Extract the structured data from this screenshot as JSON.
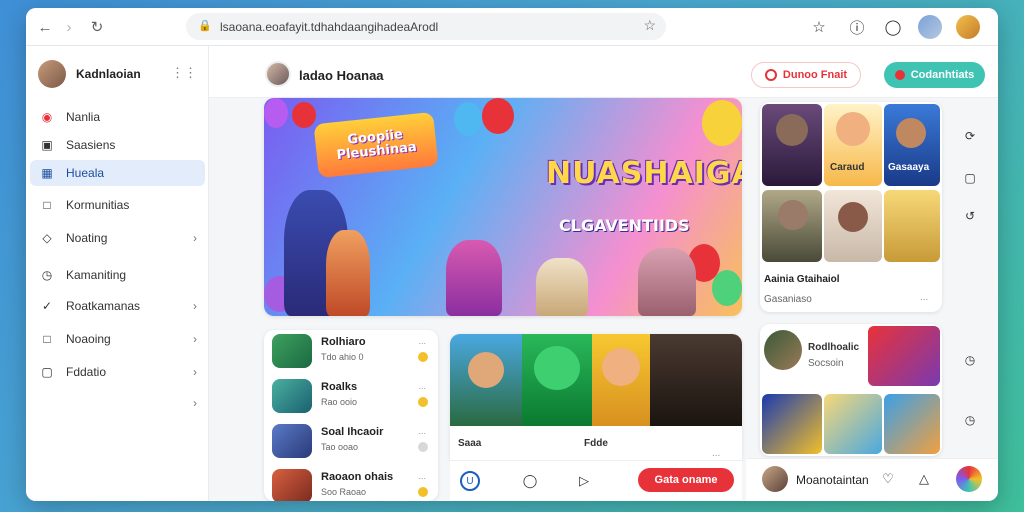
{
  "browser": {
    "address": "lsaoana.eoafayit.tdhahdaangihadeaArodl",
    "back_icon": "arrow-left-icon",
    "forward_icon": "arrow-right-icon",
    "reload_icon": "reload-icon"
  },
  "sidebar": {
    "user_name": "Kadnlaoian",
    "items": [
      {
        "label": "Nanlia",
        "icon": "record-icon",
        "chevron": false
      },
      {
        "label": "Saasiens",
        "icon": "tv-icon",
        "chevron": false
      },
      {
        "label": "Hueala",
        "icon": "grid-icon",
        "chevron": false
      },
      {
        "label": "Kormunitias",
        "icon": "chat-icon",
        "chevron": false
      },
      {
        "label": "Noating",
        "icon": "tag-icon",
        "chevron": true
      },
      {
        "label": "Kamaniting",
        "icon": "clock-icon",
        "chevron": false
      },
      {
        "label": "Roatkamanas",
        "icon": "share-icon",
        "chevron": true
      },
      {
        "label": "Noaoing",
        "icon": "box-icon",
        "chevron": true
      },
      {
        "label": "Fddatio",
        "icon": "doc-icon",
        "chevron": true
      }
    ],
    "active_index": 2
  },
  "header": {
    "title": "ladao Hoanaa",
    "pill_left": "Dunoo Fnait",
    "pill_right": "Codanhtiats"
  },
  "hero": {
    "logo_text_1": "Goopiie",
    "logo_text_2": "Pleushinaa",
    "title": "NUASHAIGA",
    "subtitle": "CLGAVENTIIDS"
  },
  "grid_panel": {
    "label_1": "Caraud",
    "label_2": "Gasaaya",
    "title": "Aainia Gtaihaiol",
    "meta": "Gasaniaso",
    "dot": "..."
  },
  "list": [
    {
      "title": "Rolhiaro",
      "meta": "Tdo ahio  0",
      "dot": "..."
    },
    {
      "title": "Roalks",
      "meta": "Rao ooio",
      "dot": "..."
    },
    {
      "title": "Soal Ihcaoir",
      "meta": "Tao ooao",
      "dot": "..."
    },
    {
      "title": "Raoaon ohais",
      "meta": "Soo Raoao",
      "dot": "..."
    }
  ],
  "video_card": {
    "left_label": "Saaa",
    "mid_label": "Fdde",
    "dot": "..."
  },
  "bottom_bar": {
    "cta": "Gata oname"
  },
  "side_feed": {
    "title": "Rodlhoalic",
    "subtitle": "Socsoin"
  },
  "footer_user": {
    "name": "Moanotaintan"
  },
  "colors": {
    "accent": "#e8323a",
    "teal": "#3fc4b4",
    "active_bg": "#e3ecfb"
  }
}
